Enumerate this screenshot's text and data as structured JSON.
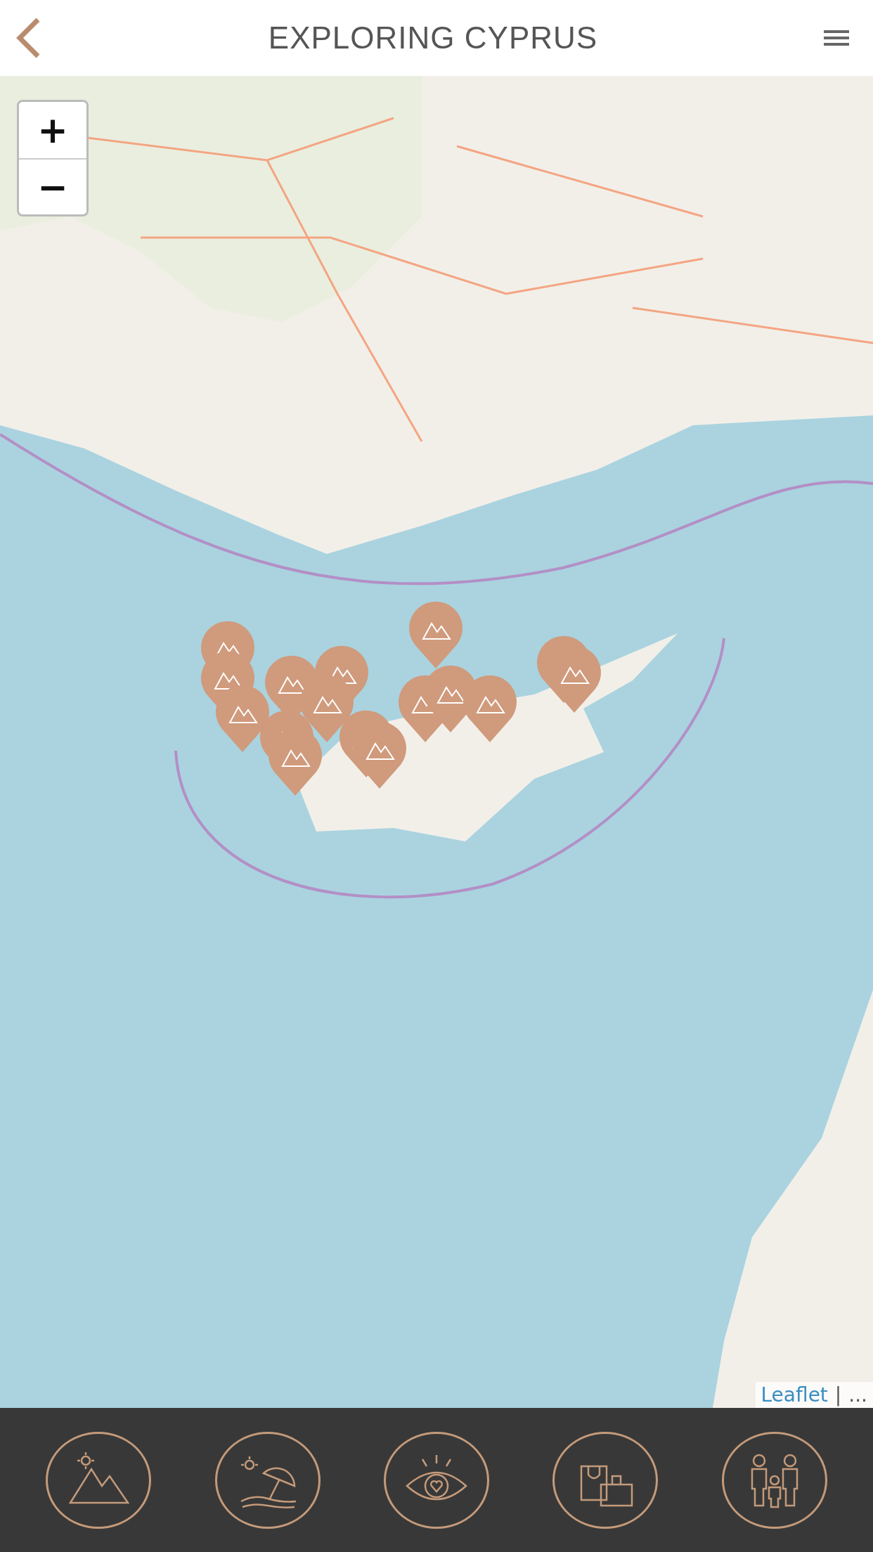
{
  "header": {
    "title": "EXPLORING CYPRUS"
  },
  "map": {
    "zoom_in": "+",
    "zoom_out": "−",
    "attribution": {
      "link": "Leaflet",
      "separator": "|",
      "rest": "..."
    }
  },
  "categories": [
    {
      "kind": "mountains"
    },
    {
      "kind": "beach"
    },
    {
      "kind": "sights"
    },
    {
      "kind": "shopping"
    },
    {
      "kind": "family"
    }
  ]
}
